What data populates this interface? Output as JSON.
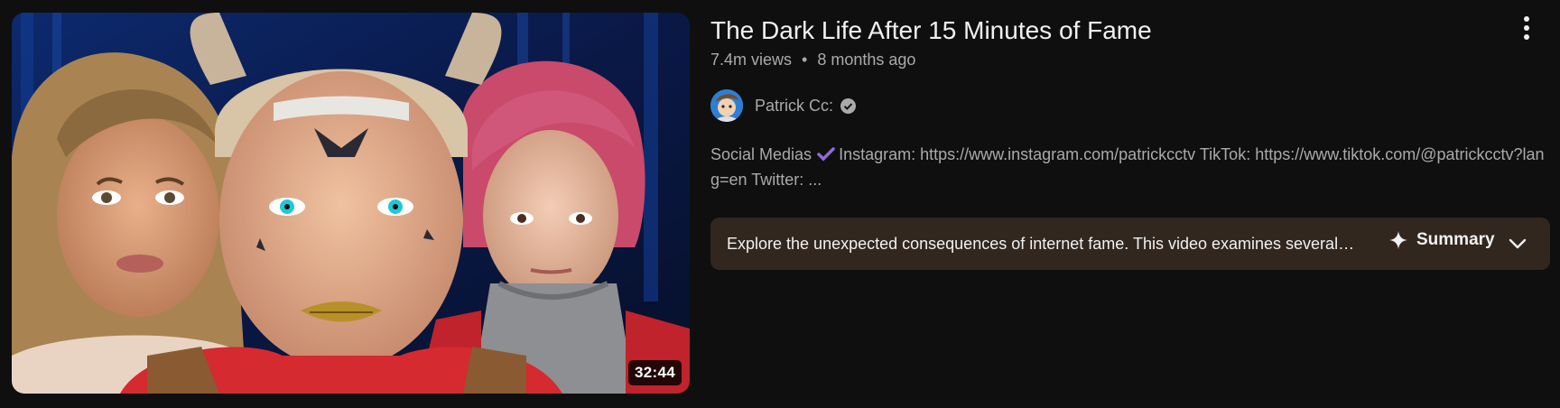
{
  "video": {
    "title": "The Dark Life After 15 Minutes of Fame",
    "views": "7.4m views",
    "separator": "•",
    "age": "8 months ago",
    "duration": "32:44"
  },
  "channel": {
    "name": "Patrick Cc:",
    "verified_icon": "verified-check-icon"
  },
  "description": {
    "prefix": "Social Medias",
    "text": "Instagram: https://www.instagram.com/patrickcctv TikTok: https://www.tiktok.com/@patrickcctv?lang=en Twitter: ..."
  },
  "summary": {
    "text": "Explore the unexpected consequences of internet fame. This video examines several…",
    "label": "Summary"
  },
  "colors": {
    "background": "#0f0f0f",
    "summary_background": "#31271f",
    "secondary_text": "#aaaaaa",
    "check_purple": "#8e6ad8"
  }
}
